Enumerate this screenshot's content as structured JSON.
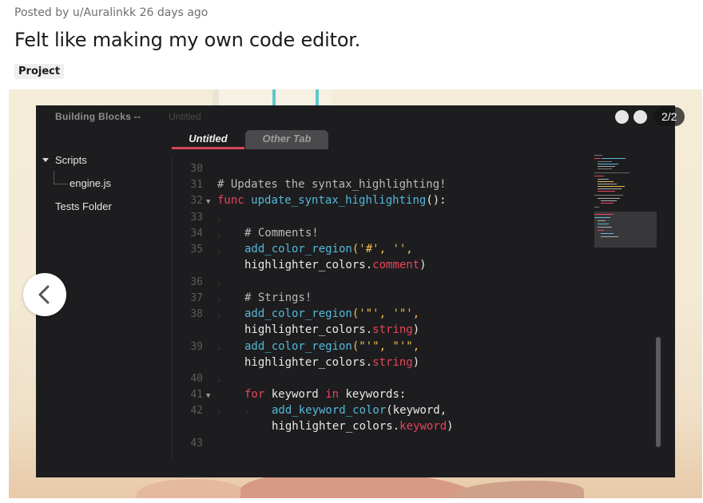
{
  "post": {
    "posted_by_prefix": "Posted by",
    "author": "u/Auralinkk",
    "age": "26 days ago",
    "title": "Felt like making my own code editor.",
    "flair": "Project"
  },
  "gallery": {
    "counter": "2/2",
    "prev_icon": "chevron-left-icon"
  },
  "editor": {
    "app_title": "Building Blocks --",
    "doc_title": "Untitled",
    "tabs": [
      {
        "label": "Untitled",
        "active": true
      },
      {
        "label": "Other Tab",
        "active": false
      }
    ],
    "tree": [
      {
        "label": "Scripts",
        "expanded": true
      },
      {
        "label": "engine.js"
      },
      {
        "label": "Tests Folder"
      }
    ],
    "line_numbers": [
      "30",
      "31",
      "32",
      "33",
      "34",
      "35",
      "",
      "36",
      "37",
      "38",
      "",
      "39",
      "",
      "40",
      "41",
      "42",
      "",
      "43"
    ],
    "code": {
      "l31": "# Updates the syntax_highlighting!",
      "l32_kw": "func",
      "l32_fn": "update_syntax_highlighting",
      "l32_tail": "():",
      "l34": "# Comments!",
      "l35_fn": "add_color_region",
      "l35_args": "('#', '',",
      "l35b_obj": "highlighter_colors",
      "l35b_prop": "comment",
      "l37": "# Strings!",
      "l38_fn": "add_color_region",
      "l38_args": "('\"', '\"',",
      "l38b_obj": "highlighter_colors",
      "l38b_prop": "string",
      "l39_fn": "add_color_region",
      "l39_args": "(\"'\", \"'\",",
      "l39b_obj": "highlighter_colors",
      "l39b_prop": "string",
      "l41_kw1": "for",
      "l41_var": "keyword",
      "l41_kw2": "in",
      "l41_list": "keywords:",
      "l42_fn": "add_keyword_color",
      "l42_args": "(keyword,",
      "l42b_obj": "highlighter_colors",
      "l42b_prop": "keyword"
    }
  },
  "colors": {
    "keyword": "#e8445c",
    "function": "#55b8d8",
    "string": "#f0c050",
    "background": "#1d1d1f"
  }
}
